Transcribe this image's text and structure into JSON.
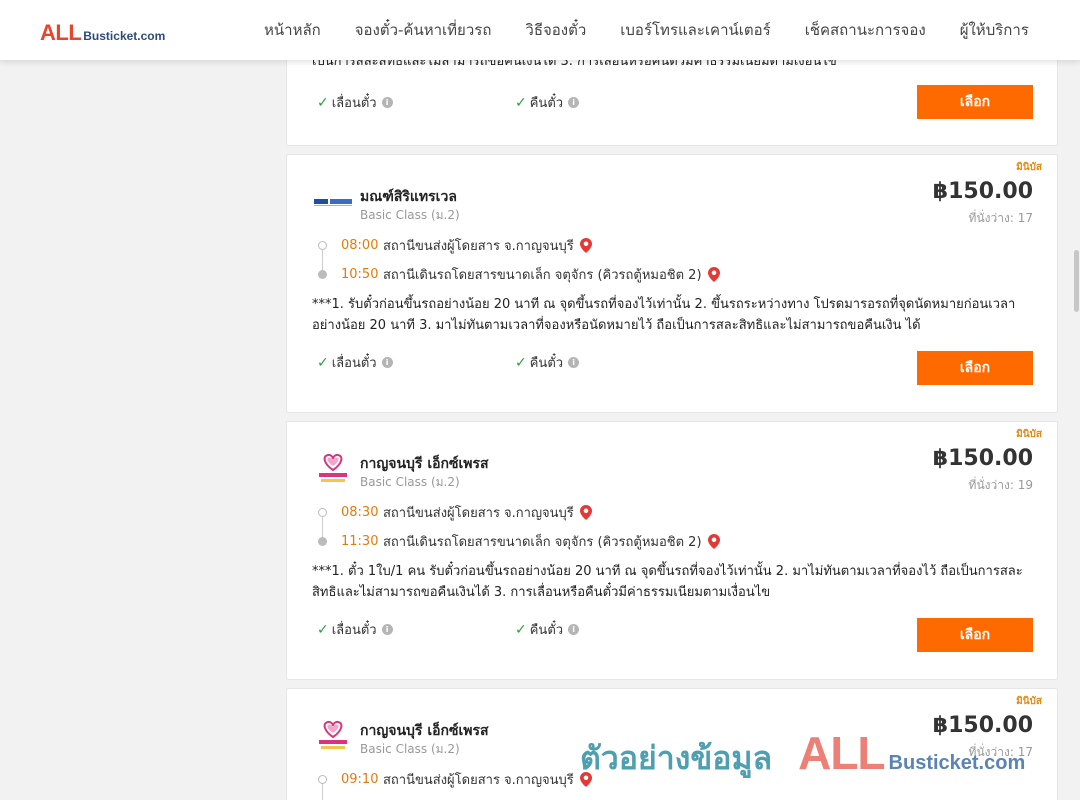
{
  "header": {
    "logo_all": "ALL",
    "logo_rest": "Busticket.com",
    "nav": [
      "หน้าหลัก",
      "จองตั๋ว-ค้นหาเที่ยวรถ",
      "วิธีจองตั๋ว",
      "เบอร์โทรและเคาน์เตอร์",
      "เช็คสถานะการจอง",
      "ผู้ให้บริการ"
    ]
  },
  "common": {
    "change_label": "เลื่อนตั๋ว",
    "refund_label": "คืนตั๋ว",
    "select_label": "เลือก",
    "seats_prefix": "ที่นั่งว่าง:",
    "minibus_badge": "มินิบัส"
  },
  "top_card": {
    "notes_tail": "เป็นการสละสิทธิและไม่สามารถขอคืนเงินได้ 3. การเลื่อนหรือคืนตั๋วมีค่าธรรมเนียมตามเงื่อนไข"
  },
  "trips": [
    {
      "operator": "มณฑ์สิริแทรเวล",
      "class": "Basic Class (ม.2)",
      "price": "฿150.00",
      "seats": "17",
      "dep_time": "08:00",
      "dep_station": "สถานีขนส่งผู้โดยสาร จ.กาญจนบุรี",
      "arr_time": "10:50",
      "arr_station": "สถานีเดินรถโดยสารขนาดเล็ก จตุจักร (คิวรถตู้หมอชิต 2)",
      "notes": "***1. รับตั๋วก่อนขึ้นรถอย่างน้อย 20 นาที ณ จุดขึ้นรถที่จองไว้เท่านั้น 2. ขึ้นรถระหว่างทาง โปรดมารอรถที่จุดนัดหมายก่อนเวลาอย่างน้อย 20 นาที 3. มาไม่ทันตามเวลาที่จองหรือนัดหมายไว้ ถือเป็นการสละสิทธิและไม่สามารถขอคืนเงิน ได้"
    },
    {
      "operator": "กาญจนบุรี เอ็กซ์เพรส",
      "class": "Basic Class (ม.2)",
      "price": "฿150.00",
      "seats": "19",
      "dep_time": "08:30",
      "dep_station": "สถานีขนส่งผู้โดยสาร จ.กาญจนบุรี",
      "arr_time": "11:30",
      "arr_station": "สถานีเดินรถโดยสารขนาดเล็ก จตุจักร (คิวรถตู้หมอชิต 2)",
      "notes": "***1. ตั๋ว 1ใบ/1 คน รับตั๋วก่อนขึ้นรถอย่างน้อย 20 นาที ณ จุดขึ้นรถที่จองไว้เท่านั้น 2. มาไม่ทันตามเวลาที่จองไว้ ถือเป็นการสละสิทธิและไม่สามารถขอคืนเงินได้ 3. การเลื่อนหรือคืนตั๋วมีค่าธรรมเนียมตามเงื่อนไข"
    },
    {
      "operator": "กาญจนบุรี เอ็กซ์เพรส",
      "class": "Basic Class (ม.2)",
      "price": "฿150.00",
      "seats": "17",
      "dep_time": "09:10",
      "dep_station": "สถานีขนส่งผู้โดยสาร จ.กาญจนบุรี"
    }
  ],
  "watermark": {
    "thai": "ตัวอย่างข้อมูล",
    "all": "ALL",
    "rest": "Busticket.com"
  },
  "colors": {
    "accent": "#ff6a00",
    "time": "#e47a0c",
    "brand_red": "#e8452c",
    "check_green": "#2e9d3e"
  }
}
